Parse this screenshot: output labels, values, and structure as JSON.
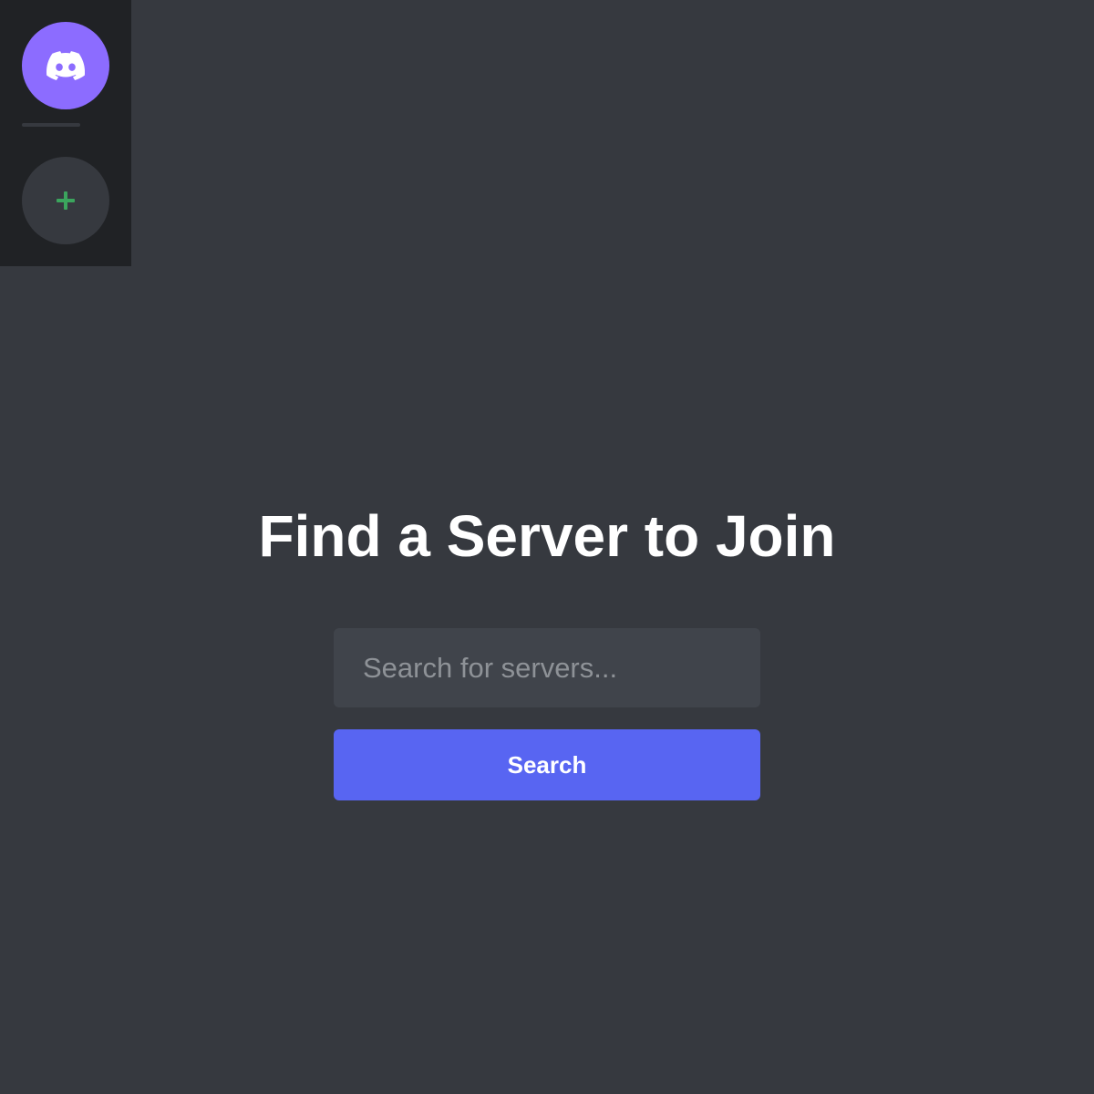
{
  "sidebar": {
    "home": {
      "icon": "discord-logo-icon",
      "color": "#8c6cff"
    },
    "add_server": {
      "icon": "plus-icon",
      "color": "#3ba55d"
    }
  },
  "main": {
    "title": "Find a Server to Join",
    "search": {
      "value": "",
      "placeholder": "Search for servers..."
    },
    "search_button_label": "Search"
  },
  "colors": {
    "background": "#36393f",
    "rail": "#202225",
    "input": "#40444b",
    "accent": "#5865f2"
  }
}
